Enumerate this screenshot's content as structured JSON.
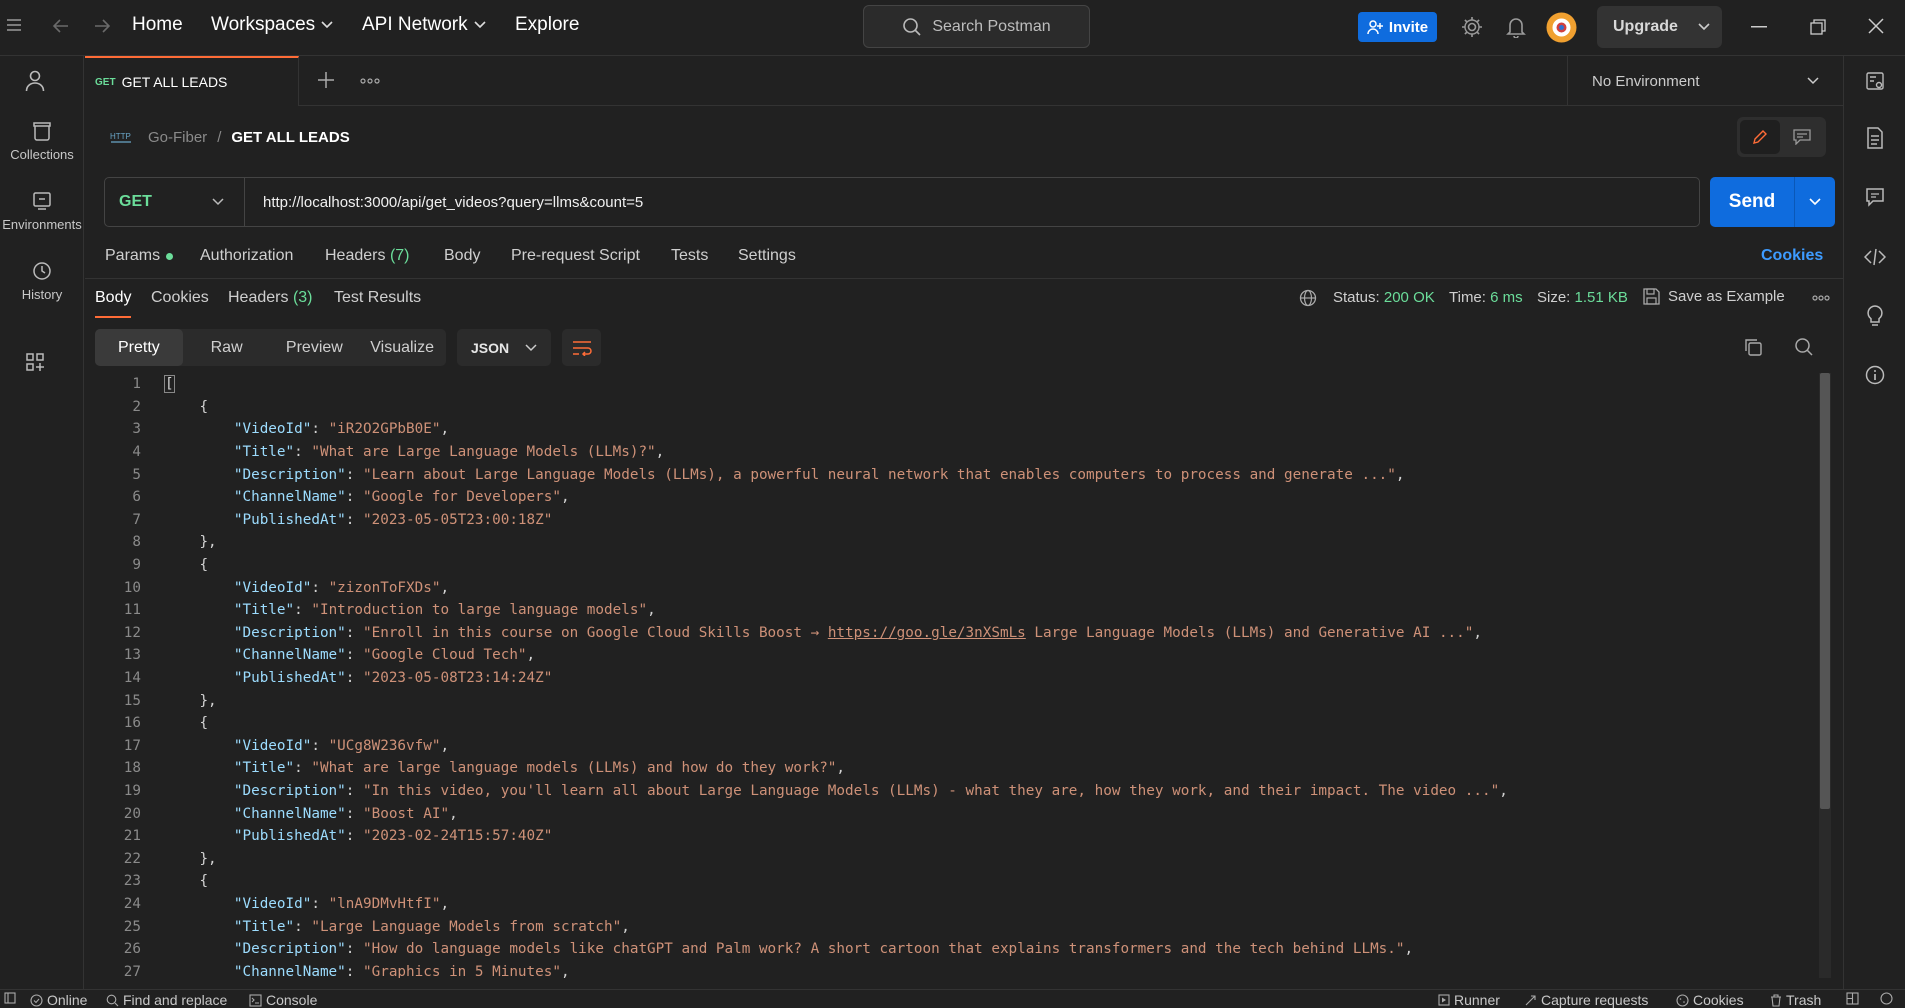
{
  "nav": {
    "home": "Home",
    "workspaces": "Workspaces",
    "api_network": "API Network",
    "explore": "Explore",
    "search_placeholder": "Search Postman",
    "invite": "Invite",
    "upgrade": "Upgrade"
  },
  "sidebar": {
    "items": [
      {
        "label": "Collections",
        "icon": "collections-icon"
      },
      {
        "label": "Environments",
        "icon": "environments-icon"
      },
      {
        "label": "History",
        "icon": "history-icon"
      }
    ]
  },
  "tabs": {
    "active": {
      "method": "GET",
      "label": "GET ALL LEADS"
    },
    "environment": "No Environment"
  },
  "breadcrumb": {
    "collection": "Go-Fiber",
    "separator": "/",
    "request": "GET ALL LEADS"
  },
  "request": {
    "method": "GET",
    "url": "http://localhost:3000/api/get_videos?query=llms&count=5",
    "send": "Send",
    "tabs": {
      "params": "Params",
      "authorization": "Authorization",
      "headers": "Headers",
      "headers_count": "(7)",
      "body": "Body",
      "prerequest": "Pre-request Script",
      "tests": "Tests",
      "settings": "Settings",
      "cookies": "Cookies"
    }
  },
  "response": {
    "tabs": {
      "body": "Body",
      "cookies": "Cookies",
      "headers": "Headers",
      "headers_count": "(3)",
      "test_results": "Test Results"
    },
    "status_label": "Status:",
    "status_value": "200 OK",
    "time_label": "Time:",
    "time_value": "6 ms",
    "size_label": "Size:",
    "size_value": "1.51 KB",
    "save_example": "Save as Example",
    "views": [
      "Pretty",
      "Raw",
      "Preview",
      "Visualize"
    ],
    "format": "JSON"
  },
  "code_lines": [
    {
      "n": "1",
      "indent": "",
      "open": "["
    },
    {
      "n": "2",
      "indent": "    ",
      "open": "{"
    },
    {
      "n": "3",
      "indent": "        ",
      "key": "\"VideoId\"",
      "val": "\"iR2O2GPbB0E\"",
      "tail": ","
    },
    {
      "n": "4",
      "indent": "        ",
      "key": "\"Title\"",
      "val": "\"What are Large Language Models (LLMs)?\"",
      "tail": ","
    },
    {
      "n": "5",
      "indent": "        ",
      "key": "\"Description\"",
      "val": "\"Learn about Large Language Models (LLMs), a powerful neural network that enables computers to process and generate ...\"",
      "tail": ","
    },
    {
      "n": "6",
      "indent": "        ",
      "key": "\"ChannelName\"",
      "val": "\"Google for Developers\"",
      "tail": ","
    },
    {
      "n": "7",
      "indent": "        ",
      "key": "\"PublishedAt\"",
      "val": "\"2023-05-05T23:00:18Z\"",
      "tail": ""
    },
    {
      "n": "8",
      "indent": "    ",
      "open": "},"
    },
    {
      "n": "9",
      "indent": "    ",
      "open": "{"
    },
    {
      "n": "10",
      "indent": "        ",
      "key": "\"VideoId\"",
      "val": "\"zizonToFXDs\"",
      "tail": ","
    },
    {
      "n": "11",
      "indent": "        ",
      "key": "\"Title\"",
      "val": "\"Introduction to large language models\"",
      "tail": ","
    },
    {
      "n": "12",
      "indent": "        ",
      "key": "\"Description\"",
      "val": "\"Enroll in this course on Google Cloud Skills Boost → ",
      "link": "https://goo.gle/3nXSmLs",
      "val2": " Large Language Models (LLMs) and Generative AI ...\"",
      "tail": ","
    },
    {
      "n": "13",
      "indent": "        ",
      "key": "\"ChannelName\"",
      "val": "\"Google Cloud Tech\"",
      "tail": ","
    },
    {
      "n": "14",
      "indent": "        ",
      "key": "\"PublishedAt\"",
      "val": "\"2023-05-08T23:14:24Z\"",
      "tail": ""
    },
    {
      "n": "15",
      "indent": "    ",
      "open": "},"
    },
    {
      "n": "16",
      "indent": "    ",
      "open": "{"
    },
    {
      "n": "17",
      "indent": "        ",
      "key": "\"VideoId\"",
      "val": "\"UCg8W236vfw\"",
      "tail": ","
    },
    {
      "n": "18",
      "indent": "        ",
      "key": "\"Title\"",
      "val": "\"What are large language models (LLMs) and how do they work?\"",
      "tail": ","
    },
    {
      "n": "19",
      "indent": "        ",
      "key": "\"Description\"",
      "val": "\"In this video, you'll learn all about Large Language Models (LLMs) - what they are, how they work, and their impact. The video ...\"",
      "tail": ","
    },
    {
      "n": "20",
      "indent": "        ",
      "key": "\"ChannelName\"",
      "val": "\"Boost AI\"",
      "tail": ","
    },
    {
      "n": "21",
      "indent": "        ",
      "key": "\"PublishedAt\"",
      "val": "\"2023-02-24T15:57:40Z\"",
      "tail": ""
    },
    {
      "n": "22",
      "indent": "    ",
      "open": "},"
    },
    {
      "n": "23",
      "indent": "    ",
      "open": "{"
    },
    {
      "n": "24",
      "indent": "        ",
      "key": "\"VideoId\"",
      "val": "\"lnA9DMvHtfI\"",
      "tail": ","
    },
    {
      "n": "25",
      "indent": "        ",
      "key": "\"Title\"",
      "val": "\"Large Language Models from scratch\"",
      "tail": ","
    },
    {
      "n": "26",
      "indent": "        ",
      "key": "\"Description\"",
      "val": "\"How do language models like chatGPT and Palm work? A short cartoon that explains transformers and the tech behind LLMs.\"",
      "tail": ","
    },
    {
      "n": "27",
      "indent": "        ",
      "key": "\"ChannelName\"",
      "val": "\"Graphics in 5 Minutes\"",
      "tail": ","
    }
  ],
  "statusbar": {
    "online": "Online",
    "find_replace": "Find and replace",
    "console": "Console",
    "runner": "Runner",
    "capture": "Capture requests",
    "cookies": "Cookies",
    "trash": "Trash"
  },
  "colors": {
    "accent": "#ff6c37",
    "primary_button": "#0f6cde",
    "success": "#6bdd9a",
    "json_key": "#9cdcfe",
    "json_string": "#ce9178"
  }
}
